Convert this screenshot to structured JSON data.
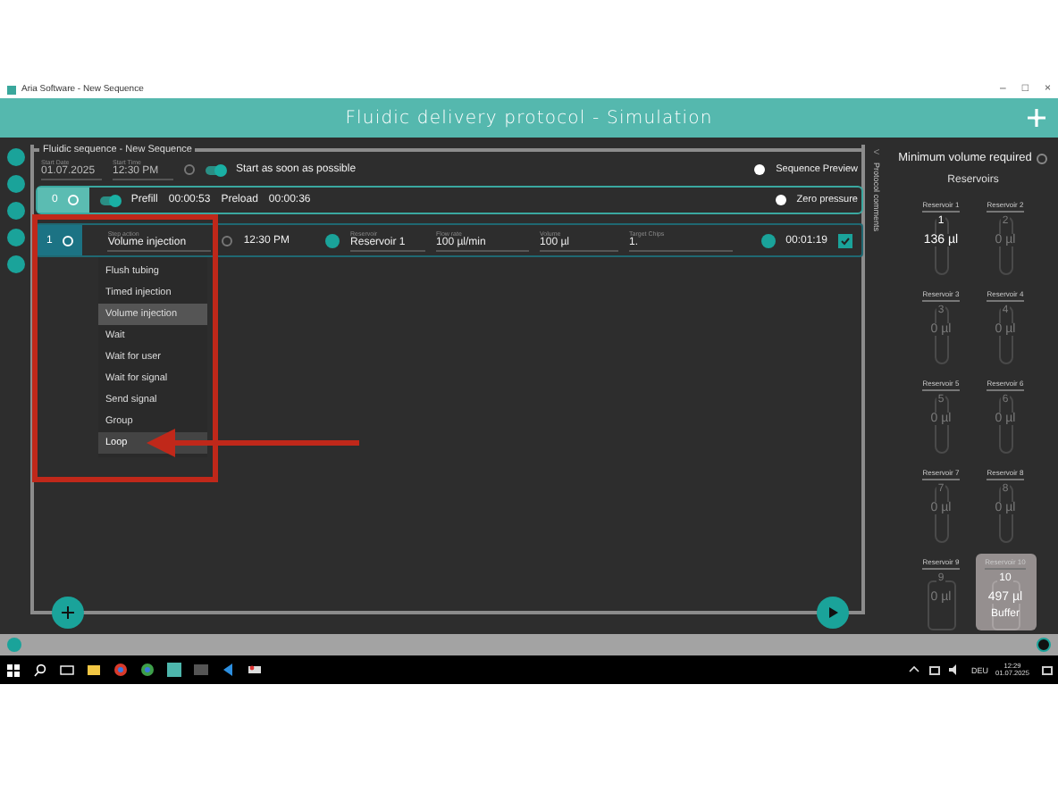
{
  "window": {
    "title": "Aria Software - New Sequence",
    "controls": [
      "–",
      "□",
      "×"
    ]
  },
  "header": {
    "title": "Fluidic delivery protocol - Simulation"
  },
  "sequence": {
    "title": "Fluidic sequence - New Sequence",
    "start_date": {
      "label": "Start Date",
      "value": "01.07.2025"
    },
    "start_time": {
      "label": "Start Time",
      "value": "12:30 PM"
    },
    "start_asap": {
      "label": "Start as soon as possible",
      "on": true
    },
    "preview": {
      "label": "Sequence Preview"
    }
  },
  "steps": [
    {
      "kind": "prefill",
      "number": "0",
      "on": true,
      "prefill": {
        "label": "Prefill",
        "value": "00:00:53"
      },
      "preload": {
        "label": "Preload",
        "value": "00:00:36"
      },
      "option": "Zero pressure"
    },
    {
      "kind": "action",
      "number": "1",
      "action": {
        "label": "Step action",
        "value": "Volume injection"
      },
      "time": "12:30 PM",
      "reservoir": {
        "label": "Reservoir",
        "value": "Reservoir 1"
      },
      "flow_rate": {
        "label": "Flow rate",
        "value": "100 µl/min"
      },
      "volume": {
        "label": "Volume",
        "value": "100",
        "unit": "µl"
      },
      "target_chips": {
        "label": "Target Chips",
        "value": "1."
      },
      "duration": "00:01:19",
      "checked": true
    }
  ],
  "action_menu": [
    {
      "label": "Flush tubing",
      "selected": false,
      "hovered": false
    },
    {
      "label": "Timed injection",
      "selected": false,
      "hovered": false
    },
    {
      "label": "Volume injection",
      "selected": true,
      "hovered": false
    },
    {
      "label": "Wait",
      "selected": false,
      "hovered": false
    },
    {
      "label": "Wait for user",
      "selected": false,
      "hovered": false
    },
    {
      "label": "Wait for signal",
      "selected": false,
      "hovered": false
    },
    {
      "label": "Send signal",
      "selected": false,
      "hovered": false
    },
    {
      "label": "Group",
      "selected": false,
      "hovered": false
    },
    {
      "label": "Loop",
      "selected": false,
      "hovered": true
    }
  ],
  "comments_tab": {
    "toggle": "<",
    "label": "Protocol comments"
  },
  "reservoirs": {
    "title": "Minimum volume required",
    "heading": "Reservoirs",
    "items": [
      {
        "label": "Reservoir 1",
        "number": "1",
        "volume": "136 µl",
        "kind": "tube",
        "active": true,
        "selected": false
      },
      {
        "label": "Reservoir 2",
        "number": "2",
        "volume": "0 µl",
        "kind": "tube",
        "active": false,
        "selected": false
      },
      {
        "label": "Reservoir 3",
        "number": "3",
        "volume": "0 µl",
        "kind": "tube",
        "active": false,
        "selected": false
      },
      {
        "label": "Reservoir 4",
        "number": "4",
        "volume": "0 µl",
        "kind": "tube",
        "active": false,
        "selected": false
      },
      {
        "label": "Reservoir 5",
        "number": "5",
        "volume": "0 µl",
        "kind": "tube",
        "active": false,
        "selected": false
      },
      {
        "label": "Reservoir 6",
        "number": "6",
        "volume": "0 µl",
        "kind": "tube",
        "active": false,
        "selected": false
      },
      {
        "label": "Reservoir 7",
        "number": "7",
        "volume": "0 µl",
        "kind": "tube",
        "active": false,
        "selected": false
      },
      {
        "label": "Reservoir 8",
        "number": "8",
        "volume": "0 µl",
        "kind": "tube",
        "active": false,
        "selected": false
      },
      {
        "label": "Reservoir 9",
        "number": "9",
        "volume": "0 µl",
        "kind": "bottle",
        "active": false,
        "selected": false
      },
      {
        "label": "Reservoir 10",
        "number": "10",
        "volume": "497 µl",
        "content": "Buffer",
        "kind": "bottle",
        "active": true,
        "selected": true
      }
    ]
  },
  "taskbar": {
    "language": "DEU",
    "time": "12:29",
    "date": "01.07.2025"
  }
}
